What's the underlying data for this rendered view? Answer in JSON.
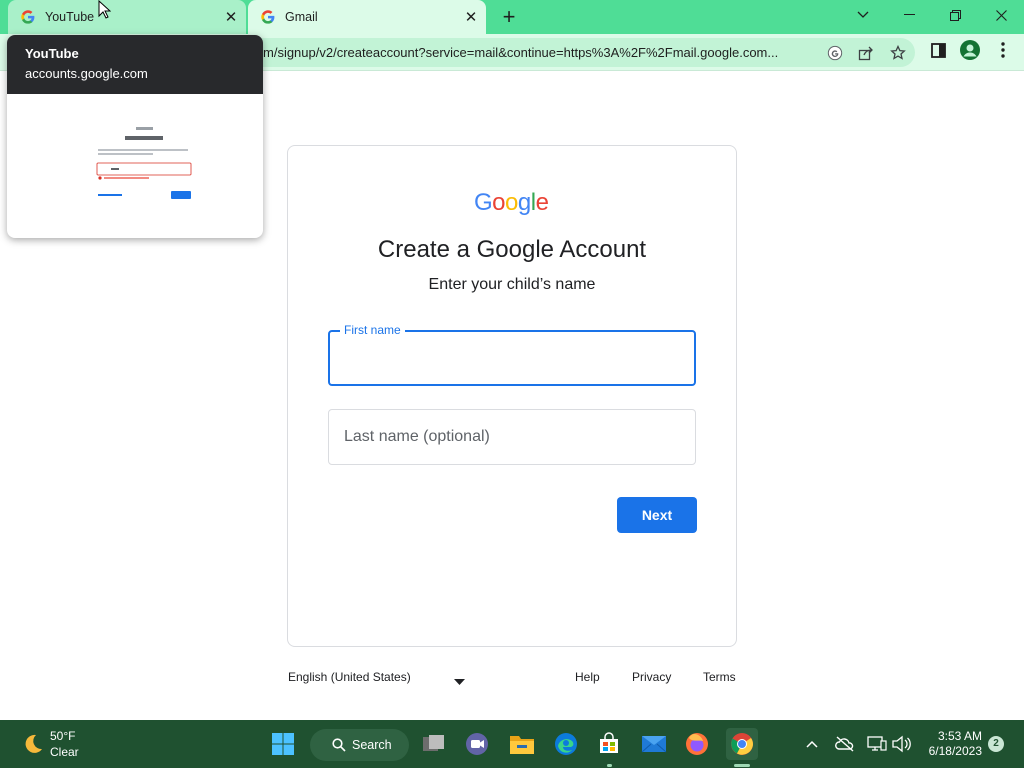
{
  "browser": {
    "tabs": [
      {
        "label": "YouTube",
        "icon": "google-g-icon"
      },
      {
        "label": "Gmail",
        "icon": "google-g-icon"
      }
    ],
    "url": "m/signup/v2/createaccount?service=mail&continue=https%3A%2F%2Fmail.google.com...",
    "new_tab_label": "+",
    "hovercard": {
      "title": "YouTube",
      "domain": "accounts.google.com"
    },
    "colors": {
      "frame": "#4fdd96",
      "toolbar": "#dcfbe8"
    }
  },
  "page": {
    "logo_text": "Google",
    "title": "Create a Google Account",
    "subtitle": "Enter your child’s name",
    "first_name": {
      "label": "First name",
      "value": ""
    },
    "last_name": {
      "placeholder": "Last name (optional)",
      "value": ""
    },
    "next_label": "Next",
    "accent": "#1a73e8"
  },
  "footer": {
    "language": "English (United States)",
    "links": [
      "Help",
      "Privacy",
      "Terms"
    ]
  },
  "taskbar": {
    "weather": {
      "temp": "50°F",
      "condition": "Clear"
    },
    "search_label": "Search",
    "clock": {
      "time": "3:53 AM",
      "date": "6/18/2023"
    },
    "notifications": "2",
    "apps": [
      "windows-start-icon",
      "search-icon",
      "task-view-icon",
      "teams-chat-icon",
      "file-explorer-icon",
      "edge-icon",
      "microsoft-store-icon",
      "mail-icon",
      "firefox-icon",
      "chrome-icon"
    ]
  }
}
